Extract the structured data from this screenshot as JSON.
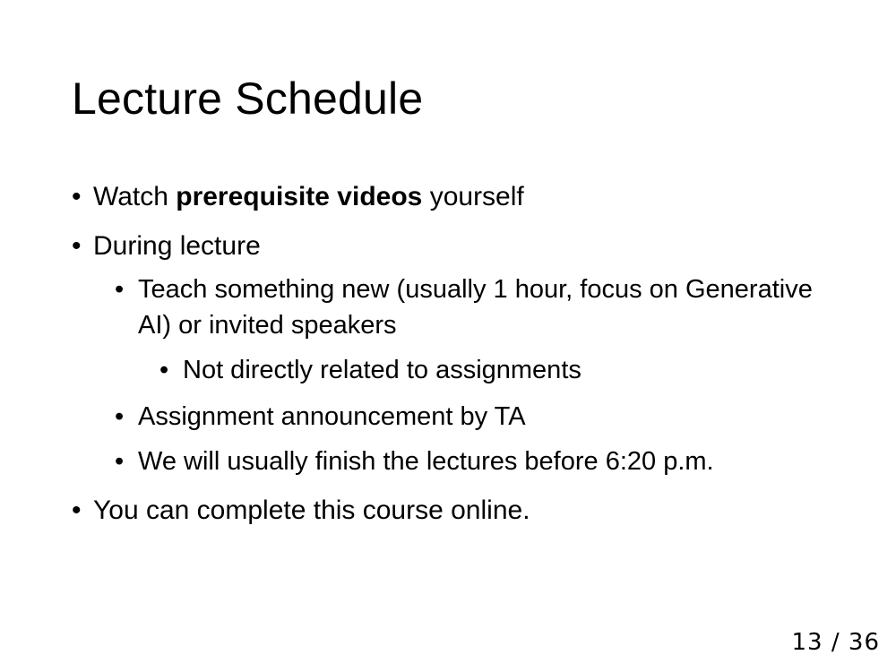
{
  "slide": {
    "title": "Lecture Schedule",
    "bullet_glyph": "•",
    "items": {
      "b1": {
        "pre": "Watch ",
        "bold": "prerequisite videos",
        "post": " yourself"
      },
      "b2": {
        "text": "During lecture"
      },
      "b2_1": {
        "text": "Teach something new (usually 1 hour, focus on Generative AI) or invited speakers"
      },
      "b2_1_1": {
        "text": "Not directly related to assignments"
      },
      "b2_2": {
        "text": "Assignment announcement by TA"
      },
      "b2_3": {
        "text": "We will usually finish the lectures before 6:20 p.m."
      },
      "b3": {
        "text": "You can complete this course online."
      }
    },
    "page": {
      "current": "13",
      "separator": "/",
      "total": "36"
    }
  }
}
